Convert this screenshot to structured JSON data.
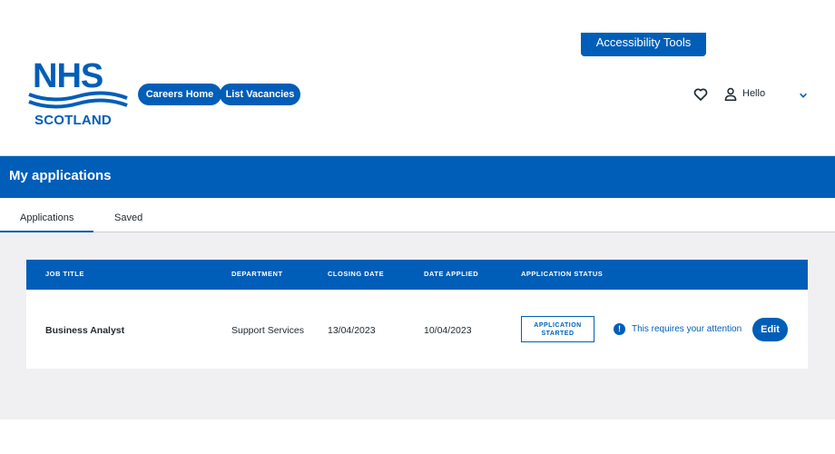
{
  "header": {
    "accessibility_label": "Accessibility Tools",
    "logo": {
      "main": "NHS",
      "sub": "SCOTLAND",
      "brand_color": "#005eb8"
    },
    "nav": [
      {
        "label": "Careers Home"
      },
      {
        "label": "List Vacancies"
      }
    ],
    "user": {
      "greeting": "Hello",
      "favorites_icon": "heart-icon",
      "user_icon": "user-icon",
      "menu_icon": "chevron-down-icon"
    }
  },
  "page": {
    "title": "My applications"
  },
  "tabs": [
    {
      "label": "Applications",
      "active": true
    },
    {
      "label": "Saved",
      "active": false
    }
  ],
  "table": {
    "headers": [
      "JOB TITLE",
      "DEPARTMENT",
      "CLOSING DATE",
      "DATE APPLIED",
      "APPLICATION STATUS"
    ],
    "rows": [
      {
        "job_title": "Business Analyst",
        "department": "Support Services",
        "closing_date": "13/04/2023",
        "date_applied": "10/04/2023",
        "status_line1": "APPLICATION",
        "status_line2": "STARTED",
        "attention_icon": "!",
        "attention_text": "This requires your attention",
        "action_label": "Edit"
      }
    ]
  },
  "colors": {
    "primary": "#005eb8",
    "background": "#f0f0f2"
  }
}
